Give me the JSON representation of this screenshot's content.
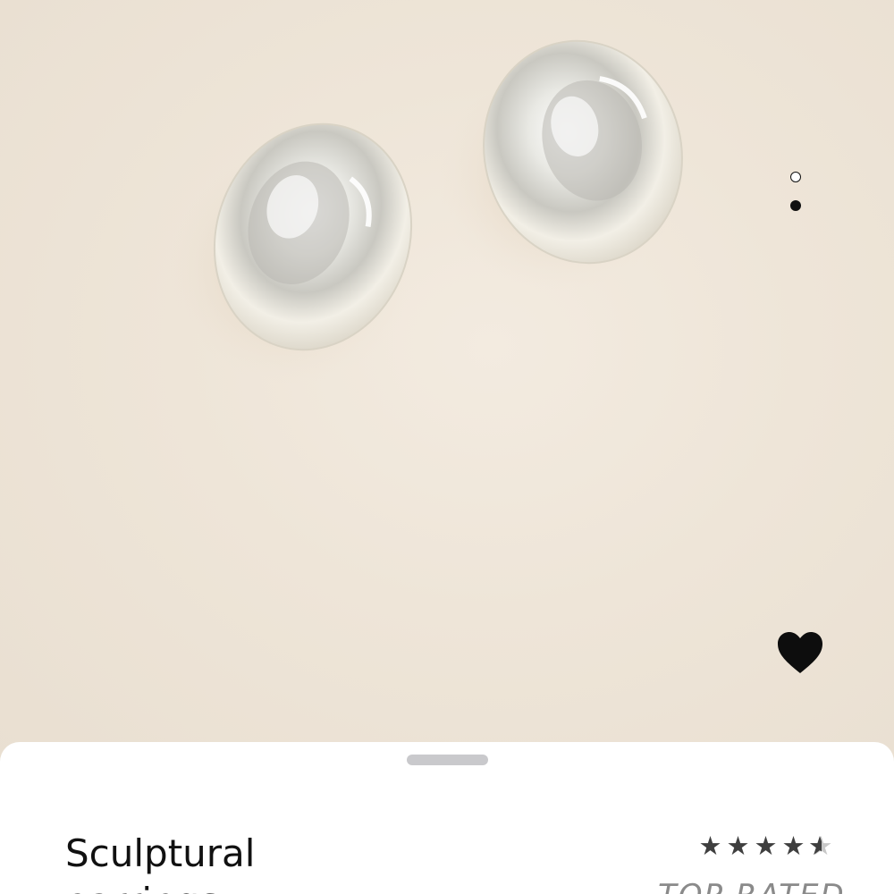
{
  "product": {
    "title": "Sculptural\nearrings",
    "rating": {
      "value": 4.5,
      "max": 5,
      "stars": [
        "★",
        "★",
        "★",
        "★",
        "★"
      ]
    },
    "badge": "TOP RATED"
  },
  "gallery": {
    "image_count": 2,
    "active_index": 1
  },
  "actions": {
    "favorite_icon": "heart-icon",
    "favorite_active": true
  },
  "colors": {
    "hero_background": "#efe6da",
    "sheet_background": "#ffffff",
    "text": "#111111",
    "badge": "#8a8a8a"
  }
}
